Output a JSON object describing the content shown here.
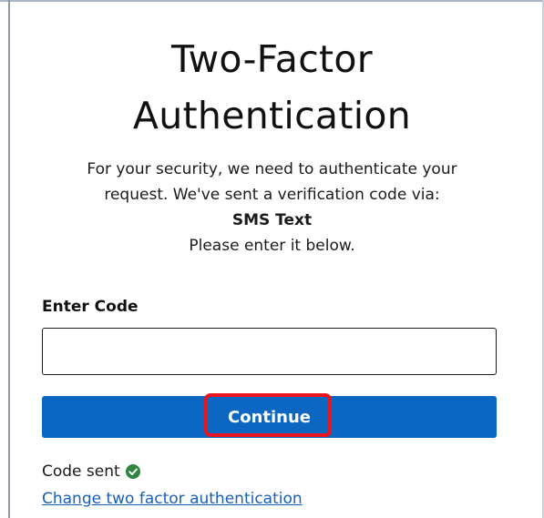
{
  "page": {
    "title_line1": "Two-Factor",
    "title_line2": "Authentication",
    "description_line1": "For your security, we need to authenticate your",
    "description_line2": "request. We've sent a verification code via:",
    "method": "SMS Text",
    "description_line3": "Please enter it below."
  },
  "form": {
    "code_label": "Enter Code",
    "code_value": "",
    "continue_label": "Continue"
  },
  "status": {
    "code_sent_text": "Code sent",
    "code_sent_icon": "check-circle-icon",
    "change_link_text": "Change two factor authentication"
  },
  "colors": {
    "button_bg": "#0b67c2",
    "highlight": "#e8141e",
    "success": "#2e8540",
    "link": "#1a5fb4"
  }
}
